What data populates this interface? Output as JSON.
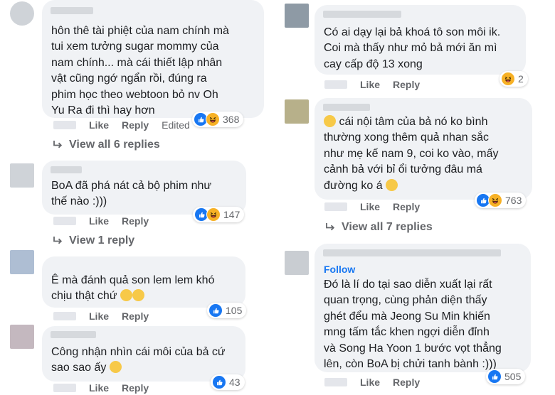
{
  "left": {
    "comments": [
      {
        "text": "hôn thê tài phiệt của nam chính mà\ntui xem tưởng sugar mommy của\nnam chính... mà cái thiết lập nhân\nvật cũng ngớ ngẩn rồi, đúng ra\nphim học theo webtoon bỏ nv Oh\nYu Ra đi thì hay hơn",
        "like": "Like",
        "reply": "Reply",
        "edited": "Edited",
        "reaction_count": "368",
        "view_replies": "View all 6 replies"
      },
      {
        "text": "BoA đã phá nát cả bộ phim như\nthế nào :)))",
        "like": "Like",
        "reply": "Reply",
        "reaction_count": "147",
        "view_replies": "View 1 reply"
      },
      {
        "text": "Ê mà đánh quả son lem lem khó\nchịu thật chứ",
        "like": "Like",
        "reply": "Reply",
        "reaction_count": "105"
      },
      {
        "text": "Công nhận nhìn cái môi của bả cứ\nsao sao ấy",
        "like": "Like",
        "reply": "Reply",
        "reaction_count": "43"
      }
    ]
  },
  "right": {
    "comments": [
      {
        "text": "Có ai dạy lại bả khoá tô son môi ik.\nCoi mà thấy như mỏ bả mới ăn mì\ncay cấp độ 13 xong",
        "like": "Like",
        "reply": "Reply",
        "reaction_count": "2"
      },
      {
        "text": "cái nội tâm của bả nó ko bình\nthường xong thêm quả nhan sắc\nnhư mẹ kế nam 9, coi ko vào, mấy\ncảnh bả với bỉ ổi tưởng đâu má\nđường ko á",
        "like": "Like",
        "reply": "Reply",
        "reaction_count": "763",
        "view_replies": "View all 7 replies"
      },
      {
        "follow": "Follow",
        "text": "Đó là lí do tại sao diễn xuất lại rất\nquan trọng, cùng phản diện thấy\nghét đểu mà Jeong Su Min khiến\nmng tấm tắc khen ngợi diễn đỉnh\nvà Song Ha Yoon 1 bước vọt thẳng\nlên, còn BoA bị chửi tanh bành :)))",
        "like": "Like",
        "reply": "Reply",
        "reaction_count": "505"
      }
    ]
  },
  "colors": {
    "like": "#1877f2",
    "haha": "#f7b125",
    "bubble": "#f0f2f5",
    "meta": "#65676b"
  }
}
